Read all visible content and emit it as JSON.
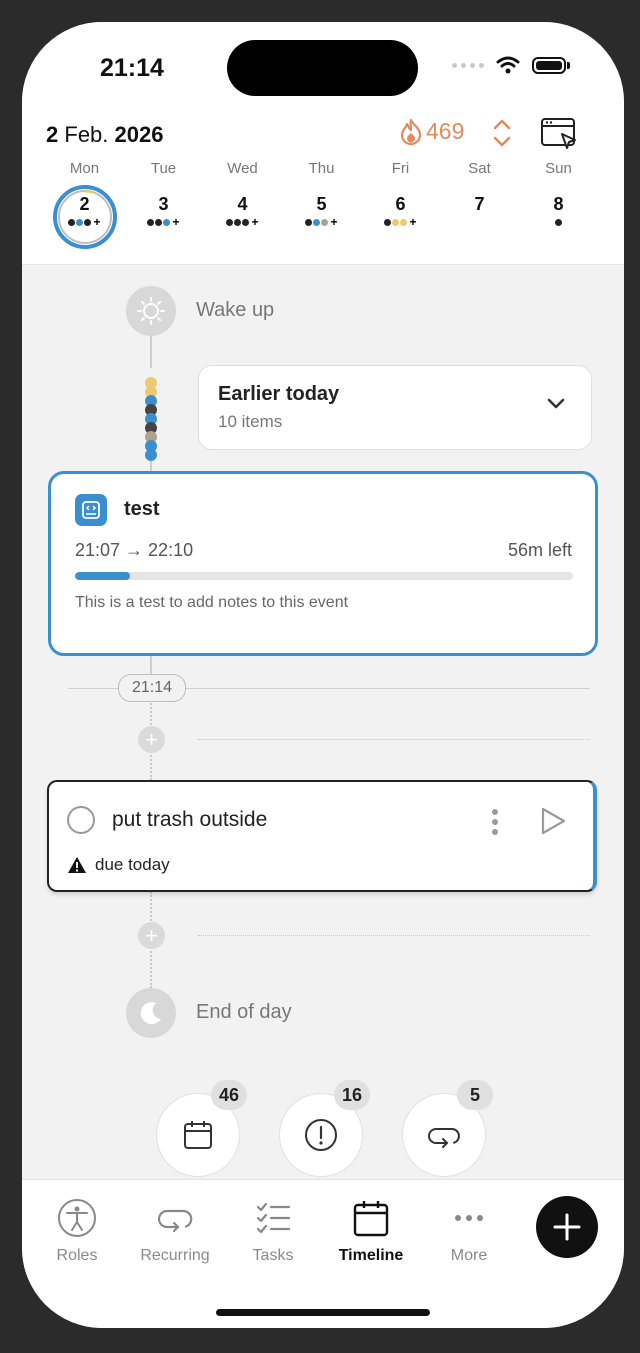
{
  "status_bar": {
    "time": "21:14"
  },
  "header": {
    "date_day": "2",
    "date_month": "Feb.",
    "date_year": "2026",
    "streak_count": "469",
    "accent_color": "#e28a5c"
  },
  "week": [
    {
      "name": "Mon",
      "num": "2",
      "selected": true,
      "dots": [
        "#222",
        "#3a8fd0",
        "#222"
      ],
      "plus": true
    },
    {
      "name": "Tue",
      "num": "3",
      "dots": [
        "#222",
        "#222",
        "#3a8fd0"
      ],
      "plus": true
    },
    {
      "name": "Wed",
      "num": "4",
      "dots": [
        "#222",
        "#222",
        "#222"
      ],
      "plus": true
    },
    {
      "name": "Thu",
      "num": "5",
      "dots": [
        "#222",
        "#3a8fd0",
        "#b0a090"
      ],
      "plus": true
    },
    {
      "name": "Fri",
      "num": "6",
      "dots": [
        "#222",
        "#f0c870",
        "#f0c870"
      ],
      "plus": true
    },
    {
      "name": "Sat",
      "num": "7",
      "dots": [],
      "plus": false
    },
    {
      "name": "Sun",
      "num": "8",
      "dots": [
        "#222"
      ],
      "plus": false
    }
  ],
  "timeline": {
    "wake_up_label": "Wake up",
    "earlier": {
      "title": "Earlier today",
      "subtitle": "10 items"
    },
    "event": {
      "title": "test",
      "time_range": "21:07 → 22:10",
      "time_left": "56m left",
      "progress": 0.11,
      "notes": "This is a test to add notes to this event",
      "color": "#3a8fd0"
    },
    "now_time": "21:14",
    "task": {
      "name": "put trash outside",
      "due": "due today"
    },
    "end_of_day_label": "End of day"
  },
  "counters": [
    {
      "icon": "calendar-icon",
      "count": "46"
    },
    {
      "icon": "exclamation-icon",
      "count": "16"
    },
    {
      "icon": "repeat-icon",
      "count": "5"
    }
  ],
  "tabs": {
    "roles": "Roles",
    "recurring": "Recurring",
    "tasks": "Tasks",
    "timeline": "Timeline",
    "more": "More"
  }
}
